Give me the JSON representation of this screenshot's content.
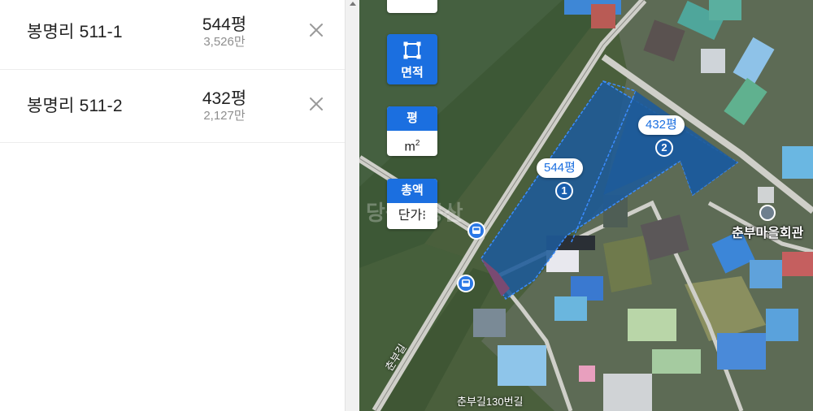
{
  "parcels": [
    {
      "name": "봉명리 511-1",
      "area": "544평",
      "price": "3,526만"
    },
    {
      "name": "봉명리 511-2",
      "area": "432평",
      "price": "2,127만"
    }
  ],
  "map": {
    "tools": {
      "area_label": "면적",
      "unit_active": "평",
      "unit_alt": "m",
      "unit_alt_sup": "2",
      "price_active": "총액",
      "price_alt": "단가",
      "price_alt_suffix": "⁝"
    },
    "callouts": [
      {
        "label": "544평",
        "number": "1"
      },
      {
        "label": "432평",
        "number": "2"
      }
    ],
    "place_label": "춘부마을회관",
    "road_labels": [
      "춘부길",
      "춘부길130번길"
    ],
    "watermark": "당근부동산",
    "colors": {
      "accent": "#1b6fe0",
      "parcel_fill": "#1e5b9a",
      "parcel_outline": "#3a8cff"
    },
    "icons": [
      "bus-icon",
      "close-icon",
      "area-select-icon",
      "poi-icon"
    ]
  }
}
